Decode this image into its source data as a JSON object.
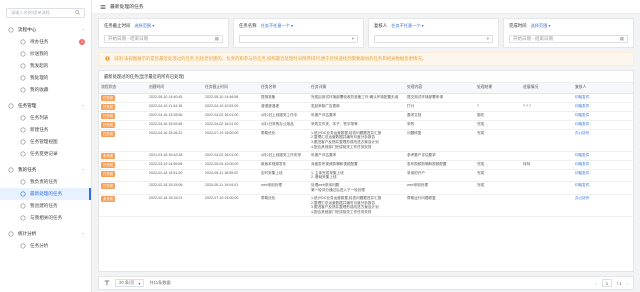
{
  "sidebar": {
    "search_placeholder": "请输入名称/提单流程",
    "items": [
      {
        "label": "流程中心",
        "group": true
      },
      {
        "label": "待办任务",
        "badge": "1"
      },
      {
        "label": "抄送我的"
      },
      {
        "label": "我发起的"
      },
      {
        "label": "我处理的"
      },
      {
        "label": "我的收藏"
      },
      {
        "label": "任务管理",
        "group": true
      },
      {
        "label": "任务列表"
      },
      {
        "label": "新建任务"
      },
      {
        "label": "任务管理视图"
      },
      {
        "label": "任务变更记录"
      },
      {
        "label": "我的任务",
        "group": true
      },
      {
        "label": "我负责的任务"
      },
      {
        "label": "最新处理的任务"
      },
      {
        "label": "我创建的任务"
      },
      {
        "label": "与我相关的任务"
      },
      {
        "label": "统计分析",
        "group": true
      },
      {
        "label": "任务分析"
      }
    ]
  },
  "topbar": {
    "title": "最新处理的任务"
  },
  "filters": [
    {
      "label": "任务截止时间",
      "select": "选择范围 ▾",
      "date": "开始日期 - 结束日期"
    },
    {
      "label": "任务名称",
      "select": "任务不任意一个 ▾",
      "date": ""
    },
    {
      "label": "复核人",
      "select": "任务不任意一个 ▾",
      "date": ""
    },
    {
      "label": "完成时间",
      "select": "选择范围 ▾",
      "date": "开始日期 - 结束日期"
    }
  ],
  "notice": "说明:该视图展示的是您最近处理过的任务,包括您创建的、负责的和参与的任务,按照最近处理时间倒序排列,便于您快速找到需要跟进的任务和相关数据变更情况。",
  "table": {
    "title": "最新处理过的任务(显示最近的所有已处理)",
    "columns": [
      "流程状态",
      "创建时间",
      "任务截止时间",
      "任务名称",
      "任务详情",
      "处理内容",
      "处理结果",
      "进展情况",
      "复核人"
    ],
    "rows": [
      {
        "status": "已完成",
        "created": "2022-05-10 14:40:45",
        "deadline": "2022-05-10 14:48:58",
        "name": "提测准备",
        "detail": "完成后测试环境部署验收的准备工作,确认环境配置无误",
        "content": "提交测试环境部署申请",
        "result": "",
        "progress": "",
        "reviewer": "印裕发件"
      },
      {
        "status": "已完成",
        "created": "2022-04-19 11:44:18",
        "deadline": "2022-04-19 10:53:00",
        "name": "灌灌灌灌灌",
        "detail": "发起审核广告更新",
        "content": "打分",
        "result": "?",
        "progress": "? ? ?",
        "reviewer": "印裕发件"
      },
      {
        "status": "已完成",
        "created": "2022-04-16 15:28:56",
        "deadline": "2022-04-02 16:01:00",
        "name": "4月2日上线服务工作中",
        "detail": "年度产评估要求",
        "content": "要求文档",
        "result": "猫吃",
        "progress": "",
        "reviewer": "印裕发件"
      },
      {
        "status": "已完成",
        "created": "2022-04-16 15:26:56",
        "deadline": "2022-04-02 16:01:00",
        "name": "4月1日采购办公用品",
        "detail": "采购文件夹、本子、签字笔等",
        "content": "采购",
        "result": "完成",
        "progress": "",
        "reviewer": "印裕发件"
      },
      {
        "status": "已完成",
        "created": "2022-04-16 15:26:22",
        "deadline": "2022-07-19 15:00:00",
        "name": "帮助优化",
        "detail": "1.统计DC业务运营数据,检查问题跟进并汇报\n2.整理汇总运营数据并编写月度分析报告\n3.跟进客户反馈并整理形成改进方案及计划\n4.配合其他部门完成相关工作任务安排",
        "content": "问题修复",
        "result": "完成",
        "progress": "",
        "reviewer": "办公协作"
      },
      {
        "status": "未完成",
        "created": "2021-03-18 15:42:28",
        "deadline": "2022-04-02 18:01:00",
        "name": "4月2日上线服务工作安排",
        "detail": "年度产评估要求",
        "content": "参考要产评估要求",
        "result": "",
        "progress": "",
        "reviewer": "印裕发件"
      },
      {
        "status": "已完成",
        "created": "2022-03-19 14:59:56",
        "deadline": "2022-05-04 10:00:00",
        "name": "新版本视频发布",
        "detail": "深度发布视频剪辑和视频配置",
        "content": "发布视频剪辑和视频配置",
        "result": "完成",
        "progress": "特特",
        "reviewer": "印裕发件"
      },
      {
        "status": "已完成",
        "created": "2022-02-18 15:51:20",
        "deadline": "2020-05-11 18:55:02",
        "name": "定时采集上线",
        "detail": "1. 主体完成采集上线\n2. 基础采集上线",
        "content": "采用的开户",
        "result": "完成",
        "progress": "",
        "reviewer": "印裕发件"
      },
      {
        "status": "已完成",
        "created": "2022-02-18 15:15:06",
        "deadline": "2020-05-11 19:04:01",
        "name": "web采用处理",
        "detail": "处理web采用问题\n第一轮评分通过后进入下一轮处理",
        "content": "web采用处理",
        "result": "完成",
        "progress": "",
        "reviewer": "印裕发件"
      },
      {
        "status": "未完成",
        "created": "2022-02-18 15:15:21",
        "deadline": "2022-07-19 15:00:00",
        "name": "帮助优化",
        "detail": "1.统计DC业务运营数据,检查问题跟进并汇报\n2.整理汇总运营数据并编写月度分析报告\n3.跟进客户反馈并整理形成改进方案及计划\n4.配合其他部门完成相关工作任务安排",
        "content": "帮助运行问题修复",
        "result": "",
        "progress": "",
        "reviewer": "办公协作"
      }
    ]
  },
  "pager": {
    "size": "20 条/页",
    "total": "共11条数据",
    "page": "1",
    "pages": "/ 1"
  },
  "colors": {
    "accent": "#2f6fe0",
    "tag": "#f5a15b",
    "warn": "#e6a23c"
  }
}
